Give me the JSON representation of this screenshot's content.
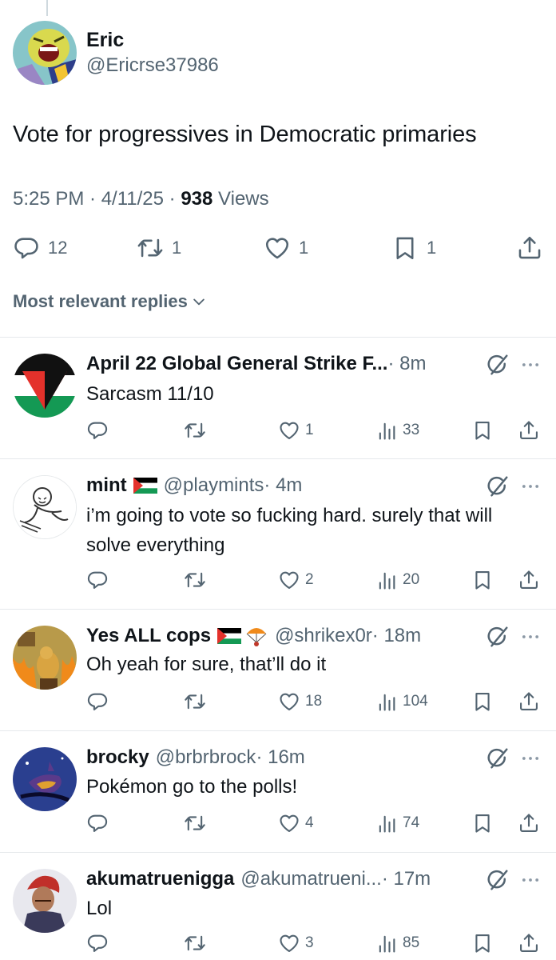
{
  "post": {
    "name": "Eric",
    "handle": "@Ericrse37986",
    "text": "Vote for progressives in Democratic primaries",
    "time": "5:25 PM · 4/11/25 · ",
    "views_count": "938",
    "views_label": " Views",
    "replies": "12",
    "reposts": "1",
    "likes": "1",
    "bookmarks": "1"
  },
  "sort_label": "Most relevant replies",
  "replies": [
    {
      "name": "April 22 Global General Strike F...",
      "handle": "",
      "time": " · 8m",
      "text": "Sarcasm 11/10",
      "likes": "1",
      "views": "33"
    },
    {
      "name": "mint",
      "handle": "@playmints",
      "time": " · 4m",
      "text": "i’m going to vote so fucking hard. surely that will solve everything",
      "likes": "2",
      "views": "20"
    },
    {
      "name": "Yes ALL cops",
      "handle": "@shrikex0r",
      "time": " · 18m",
      "text": "Oh yeah for sure, that’ll do it",
      "likes": "18",
      "views": "104"
    },
    {
      "name": "brocky",
      "handle": "@brbrbrock",
      "time": " · 16m",
      "text": "Pokémon go to the polls!",
      "likes": "4",
      "views": "74"
    },
    {
      "name": "akumatruenigga",
      "handle": "@akumatrueni...",
      "time": " · 17m",
      "text": "Lol",
      "likes": "3",
      "views": "85"
    }
  ],
  "colors": {
    "text": "#0f1419",
    "secondary": "#536471",
    "divider": "#e6e9eb",
    "background": "#ffffff"
  },
  "icons": [
    "reply-icon",
    "repost-icon",
    "like-icon",
    "bookmark-icon",
    "share-icon",
    "views-icon",
    "grok-icon",
    "more-icon",
    "chevron-down-icon",
    "palestine-flag-icon",
    "parachute-icon"
  ]
}
